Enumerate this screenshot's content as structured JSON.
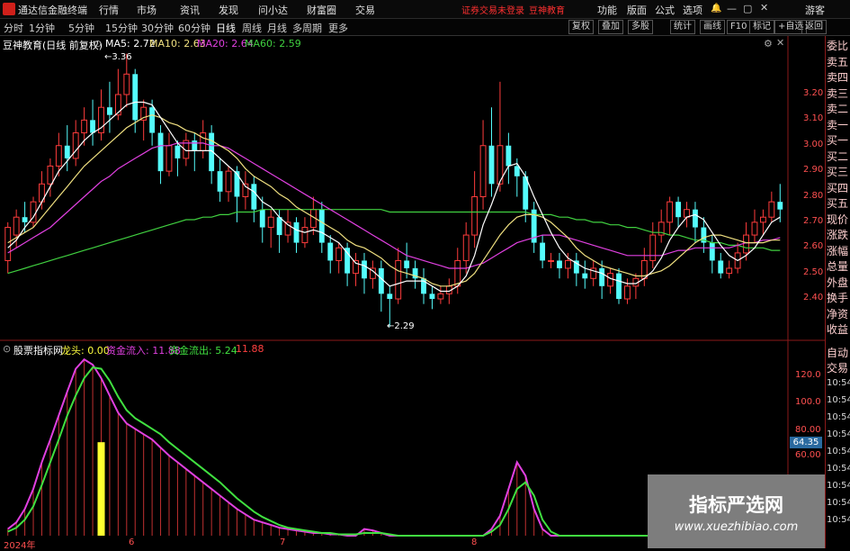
{
  "app": {
    "title": "通达信金融终端",
    "menu": [
      "行情",
      "市场",
      "资讯",
      "发现",
      "问小达",
      "财富圈",
      "交易"
    ],
    "notice": "证券交易未登录",
    "notice2": "豆神教育",
    "right_menu": [
      "功能",
      "版面",
      "公式",
      "选项"
    ],
    "guest": "游客"
  },
  "toolbar": {
    "periods": [
      "分时",
      "1分钟",
      "5分钟",
      "15分钟",
      "30分钟",
      "60分钟",
      "日线",
      "周线",
      "月线",
      "多周期",
      "更多"
    ],
    "buttons": [
      "复权",
      "叠加",
      "多股",
      "统计",
      "画线",
      "F10",
      "标记",
      "+自选",
      "返回"
    ]
  },
  "main_chart": {
    "stock_label": "豆神教育(日线 前复权)",
    "ma": [
      {
        "name": "MA5: 2.72",
        "color": "#ffffff"
      },
      {
        "name": "MA10: 2.63",
        "color": "#f0e080"
      },
      {
        "name": "MA20: 2.64",
        "color": "#e040e0"
      },
      {
        "name": "MA60: 2.59",
        "color": "#40d040"
      }
    ],
    "high_label": "3.36",
    "low_label": "2.29",
    "y_ticks": [
      "3.20",
      "3.10",
      "3.00",
      "2.90",
      "2.80",
      "2.70",
      "2.60",
      "2.50",
      "2.40"
    ]
  },
  "sub_chart": {
    "label": "股票指标网",
    "indicators": [
      {
        "name": "龙头: 0.00",
        "color": "#ffff40"
      },
      {
        "name": "资金流入: 11.88",
        "color": "#e040e0"
      },
      {
        "name": "资金流出: 5.24",
        "color": "#40e040"
      },
      {
        "name": "11.88",
        "color": "#ff4040"
      }
    ],
    "y_ticks": [
      "120.0",
      "100.0",
      "80.00",
      "60.00"
    ],
    "price_tag": "64.35",
    "x_labels": [
      "2024年",
      "6",
      "7",
      "8"
    ]
  },
  "right_panel": {
    "items": [
      "委比",
      "卖五",
      "卖四",
      "卖三",
      "卖二",
      "卖一",
      "买一",
      "买二",
      "买三",
      "买四",
      "买五",
      "现价",
      "涨跌",
      "涨幅",
      "总量",
      "外盘",
      "换手",
      "净资",
      "收益"
    ],
    "trade_items": [
      "自动",
      "交易"
    ],
    "times": [
      "10:54",
      "10:54",
      "10:54",
      "10:54",
      "10:54",
      "10:54",
      "10:54",
      "10:54",
      "10:54"
    ]
  },
  "watermark": {
    "title": "指标严选网",
    "url": "www.xuezhibiao.com"
  },
  "chart_data": {
    "type": "candlestick",
    "price_range": [
      2.29,
      3.36
    ],
    "candles": [
      [
        2.55,
        2.68,
        2.5,
        2.7
      ],
      [
        2.65,
        2.72,
        2.6,
        2.75
      ],
      [
        2.72,
        2.7,
        2.66,
        2.78
      ],
      [
        2.7,
        2.78,
        2.68,
        2.8
      ],
      [
        2.78,
        2.85,
        2.75,
        2.9
      ],
      [
        2.85,
        2.92,
        2.8,
        2.95
      ],
      [
        2.92,
        3.0,
        2.88,
        3.05
      ],
      [
        3.0,
        2.95,
        2.9,
        3.08
      ],
      [
        2.95,
        3.05,
        2.92,
        3.1
      ],
      [
        3.05,
        3.1,
        3.0,
        3.15
      ],
      [
        3.1,
        3.05,
        3.0,
        3.18
      ],
      [
        3.05,
        3.15,
        3.02,
        3.22
      ],
      [
        3.15,
        3.12,
        3.05,
        3.25
      ],
      [
        3.12,
        3.2,
        3.1,
        3.3
      ],
      [
        3.2,
        3.28,
        3.15,
        3.36
      ],
      [
        3.28,
        3.1,
        3.05,
        3.3
      ],
      [
        3.1,
        3.15,
        3.02,
        3.18
      ],
      [
        3.15,
        3.05,
        3.0,
        3.18
      ],
      [
        3.05,
        2.9,
        2.85,
        3.08
      ],
      [
        2.9,
        3.0,
        2.88,
        3.05
      ],
      [
        3.0,
        2.95,
        2.88,
        3.02
      ],
      [
        2.95,
        3.02,
        2.92,
        3.05
      ],
      [
        3.02,
        2.98,
        2.9,
        3.05
      ],
      [
        2.98,
        3.05,
        2.95,
        3.1
      ],
      [
        3.05,
        2.9,
        2.85,
        3.08
      ],
      [
        2.9,
        2.82,
        2.78,
        2.95
      ],
      [
        2.82,
        2.9,
        2.78,
        2.92
      ],
      [
        2.9,
        2.8,
        2.7,
        2.92
      ],
      [
        2.8,
        2.85,
        2.75,
        2.9
      ],
      [
        2.85,
        2.75,
        2.7,
        2.88
      ],
      [
        2.75,
        2.68,
        2.62,
        2.8
      ],
      [
        2.68,
        2.72,
        2.6,
        2.75
      ],
      [
        2.72,
        2.65,
        2.58,
        2.75
      ],
      [
        2.65,
        2.7,
        2.62,
        2.75
      ],
      [
        2.7,
        2.62,
        2.58,
        2.72
      ],
      [
        2.62,
        2.68,
        2.6,
        2.72
      ],
      [
        2.68,
        2.75,
        2.65,
        2.8
      ],
      [
        2.75,
        2.62,
        2.58,
        2.78
      ],
      [
        2.62,
        2.55,
        2.5,
        2.65
      ],
      [
        2.55,
        2.6,
        2.5,
        2.62
      ],
      [
        2.6,
        2.5,
        2.45,
        2.62
      ],
      [
        2.5,
        2.55,
        2.45,
        2.58
      ],
      [
        2.55,
        2.48,
        2.42,
        2.58
      ],
      [
        2.48,
        2.52,
        2.44,
        2.55
      ],
      [
        2.52,
        2.42,
        2.35,
        2.55
      ],
      [
        2.42,
        2.4,
        2.29,
        2.45
      ],
      [
        2.4,
        2.55,
        2.38,
        2.6
      ],
      [
        2.55,
        2.52,
        2.48,
        2.62
      ],
      [
        2.52,
        2.48,
        2.44,
        2.55
      ],
      [
        2.48,
        2.42,
        2.38,
        2.52
      ],
      [
        2.42,
        2.4,
        2.36,
        2.45
      ],
      [
        2.4,
        2.42,
        2.38,
        2.45
      ],
      [
        2.42,
        2.45,
        2.38,
        2.48
      ],
      [
        2.45,
        2.55,
        2.42,
        2.6
      ],
      [
        2.55,
        2.65,
        2.5,
        2.7
      ],
      [
        2.65,
        2.8,
        2.6,
        2.9
      ],
      [
        2.8,
        3.0,
        2.75,
        3.1
      ],
      [
        3.0,
        2.85,
        2.8,
        3.15
      ],
      [
        2.85,
        3.0,
        2.82,
        3.25
      ],
      [
        3.0,
        2.92,
        2.85,
        3.05
      ],
      [
        2.92,
        2.88,
        2.8,
        2.95
      ],
      [
        2.88,
        2.75,
        2.7,
        2.9
      ],
      [
        2.75,
        2.62,
        2.58,
        2.78
      ],
      [
        2.62,
        2.55,
        2.52,
        2.65
      ],
      [
        2.55,
        2.55,
        2.52,
        2.58
      ],
      [
        2.55,
        2.52,
        2.48,
        2.58
      ],
      [
        2.52,
        2.55,
        2.48,
        2.58
      ],
      [
        2.55,
        2.5,
        2.45,
        2.58
      ],
      [
        2.5,
        2.48,
        2.44,
        2.55
      ],
      [
        2.48,
        2.52,
        2.45,
        2.55
      ],
      [
        2.52,
        2.45,
        2.4,
        2.55
      ],
      [
        2.45,
        2.5,
        2.42,
        2.52
      ],
      [
        2.5,
        2.4,
        2.38,
        2.52
      ],
      [
        2.4,
        2.45,
        2.38,
        2.48
      ],
      [
        2.45,
        2.48,
        2.4,
        2.5
      ],
      [
        2.48,
        2.55,
        2.45,
        2.6
      ],
      [
        2.55,
        2.65,
        2.52,
        2.7
      ],
      [
        2.65,
        2.7,
        2.62,
        2.75
      ],
      [
        2.7,
        2.78,
        2.65,
        2.8
      ],
      [
        2.78,
        2.72,
        2.68,
        2.8
      ],
      [
        2.72,
        2.75,
        2.68,
        2.78
      ],
      [
        2.75,
        2.68,
        2.62,
        2.78
      ],
      [
        2.68,
        2.62,
        2.58,
        2.72
      ],
      [
        2.62,
        2.55,
        2.5,
        2.65
      ],
      [
        2.55,
        2.5,
        2.48,
        2.58
      ],
      [
        2.5,
        2.52,
        2.48,
        2.55
      ],
      [
        2.52,
        2.58,
        2.5,
        2.62
      ],
      [
        2.58,
        2.65,
        2.55,
        2.7
      ],
      [
        2.65,
        2.7,
        2.62,
        2.75
      ],
      [
        2.7,
        2.72,
        2.65,
        2.75
      ],
      [
        2.72,
        2.78,
        2.7,
        2.82
      ],
      [
        2.78,
        2.75,
        2.7,
        2.85
      ]
    ],
    "ma5": [
      2.6,
      2.63,
      2.68,
      2.72,
      2.78,
      2.84,
      2.9,
      2.94,
      2.98,
      3.02,
      3.05,
      3.07,
      3.1,
      3.13,
      3.16,
      3.17,
      3.17,
      3.16,
      3.11,
      3.06,
      3.01,
      2.98,
      2.98,
      2.98,
      2.98,
      2.95,
      2.92,
      2.89,
      2.84,
      2.82,
      2.78,
      2.76,
      2.72,
      2.69,
      2.67,
      2.66,
      2.67,
      2.66,
      2.64,
      2.62,
      2.58,
      2.54,
      2.53,
      2.51,
      2.48,
      2.45,
      2.46,
      2.47,
      2.47,
      2.47,
      2.45,
      2.43,
      2.43,
      2.45,
      2.49,
      2.57,
      2.69,
      2.77,
      2.86,
      2.92,
      2.93,
      2.88,
      2.8,
      2.73,
      2.66,
      2.6,
      2.56,
      2.54,
      2.52,
      2.51,
      2.5,
      2.48,
      2.47,
      2.46,
      2.46,
      2.48,
      2.51,
      2.56,
      2.63,
      2.68,
      2.72,
      2.73,
      2.71,
      2.66,
      2.61,
      2.57,
      2.55,
      2.57,
      2.6,
      2.65,
      2.7,
      2.72
    ],
    "ma10": [
      2.62,
      2.64,
      2.66,
      2.68,
      2.72,
      2.76,
      2.8,
      2.84,
      2.88,
      2.92,
      2.95,
      2.98,
      3.01,
      3.04,
      3.07,
      3.09,
      3.11,
      3.12,
      3.11,
      3.09,
      3.08,
      3.06,
      3.05,
      3.03,
      3.02,
      3.0,
      2.98,
      2.95,
      2.91,
      2.88,
      2.86,
      2.84,
      2.81,
      2.79,
      2.76,
      2.74,
      2.72,
      2.7,
      2.68,
      2.66,
      2.63,
      2.61,
      2.6,
      2.58,
      2.56,
      2.53,
      2.51,
      2.5,
      2.49,
      2.48,
      2.46,
      2.45,
      2.45,
      2.46,
      2.47,
      2.5,
      2.55,
      2.6,
      2.65,
      2.69,
      2.72,
      2.73,
      2.73,
      2.72,
      2.7,
      2.67,
      2.64,
      2.6,
      2.57,
      2.55,
      2.53,
      2.52,
      2.51,
      2.5,
      2.49,
      2.49,
      2.5,
      2.51,
      2.53,
      2.56,
      2.59,
      2.62,
      2.64,
      2.65,
      2.65,
      2.64,
      2.63,
      2.62,
      2.62,
      2.62,
      2.63,
      2.63
    ],
    "ma20": [
      2.58,
      2.6,
      2.62,
      2.64,
      2.66,
      2.68,
      2.71,
      2.74,
      2.77,
      2.8,
      2.83,
      2.86,
      2.88,
      2.91,
      2.93,
      2.95,
      2.97,
      2.99,
      3.0,
      3.0,
      3.01,
      3.01,
      3.01,
      3.01,
      3.0,
      3.0,
      2.99,
      2.97,
      2.95,
      2.93,
      2.91,
      2.89,
      2.87,
      2.85,
      2.83,
      2.81,
      2.79,
      2.77,
      2.75,
      2.73,
      2.71,
      2.69,
      2.67,
      2.65,
      2.63,
      2.61,
      2.59,
      2.57,
      2.56,
      2.55,
      2.54,
      2.53,
      2.52,
      2.52,
      2.52,
      2.53,
      2.54,
      2.56,
      2.58,
      2.6,
      2.62,
      2.63,
      2.64,
      2.65,
      2.65,
      2.65,
      2.64,
      2.63,
      2.62,
      2.61,
      2.6,
      2.59,
      2.58,
      2.57,
      2.57,
      2.57,
      2.57,
      2.57,
      2.58,
      2.59,
      2.59,
      2.6,
      2.6,
      2.6,
      2.6,
      2.6,
      2.61,
      2.62,
      2.62,
      2.63,
      2.63,
      2.64
    ],
    "ma60": [
      2.5,
      2.51,
      2.52,
      2.53,
      2.54,
      2.55,
      2.56,
      2.57,
      2.58,
      2.59,
      2.6,
      2.61,
      2.62,
      2.63,
      2.64,
      2.65,
      2.66,
      2.67,
      2.68,
      2.69,
      2.7,
      2.71,
      2.71,
      2.72,
      2.72,
      2.73,
      2.73,
      2.74,
      2.74,
      2.74,
      2.75,
      2.75,
      2.75,
      2.75,
      2.75,
      2.75,
      2.75,
      2.75,
      2.75,
      2.75,
      2.75,
      2.75,
      2.75,
      2.75,
      2.75,
      2.74,
      2.74,
      2.74,
      2.74,
      2.74,
      2.74,
      2.74,
      2.74,
      2.74,
      2.74,
      2.74,
      2.74,
      2.74,
      2.74,
      2.74,
      2.74,
      2.74,
      2.73,
      2.73,
      2.73,
      2.72,
      2.72,
      2.71,
      2.71,
      2.7,
      2.7,
      2.69,
      2.69,
      2.68,
      2.68,
      2.67,
      2.66,
      2.66,
      2.65,
      2.65,
      2.64,
      2.63,
      2.63,
      2.62,
      2.62,
      2.61,
      2.61,
      2.6,
      2.6,
      2.6,
      2.59,
      2.59
    ],
    "flow_in": [
      5,
      10,
      20,
      35,
      55,
      72,
      90,
      108,
      125,
      132,
      128,
      118,
      105,
      92,
      84,
      80,
      76,
      72,
      66,
      60,
      55,
      50,
      45,
      40,
      35,
      30,
      25,
      20,
      16,
      12,
      10,
      8,
      6,
      5,
      4,
      3,
      2,
      2,
      1,
      1,
      0,
      0,
      5,
      4,
      2,
      0,
      0,
      0,
      0,
      0,
      0,
      0,
      0,
      0,
      0,
      0,
      0,
      5,
      15,
      35,
      55,
      45,
      20,
      5,
      0,
      0,
      0,
      0,
      0,
      0,
      0,
      0,
      0,
      0,
      0,
      0,
      0,
      0,
      0,
      0,
      0,
      0,
      0,
      0,
      0,
      0,
      0,
      0,
      0,
      0,
      0,
      0
    ],
    "flow_out": [
      3,
      6,
      12,
      22,
      38,
      55,
      72,
      90,
      105,
      118,
      126,
      125,
      116,
      104,
      94,
      88,
      84,
      80,
      76,
      70,
      65,
      60,
      55,
      50,
      45,
      40,
      34,
      28,
      23,
      18,
      14,
      11,
      8,
      6,
      5,
      4,
      3,
      2,
      2,
      1,
      1,
      1,
      2,
      2,
      2,
      1,
      0,
      0,
      0,
      0,
      0,
      0,
      0,
      0,
      0,
      0,
      0,
      3,
      8,
      20,
      35,
      40,
      30,
      12,
      3,
      0,
      0,
      0,
      0,
      0,
      0,
      0,
      0,
      0,
      0,
      0,
      0,
      0,
      0,
      0,
      0,
      0,
      0,
      0,
      0,
      0,
      0,
      0,
      0,
      0,
      0,
      0
    ],
    "leader_bar_index": 11,
    "sub_range": [
      0,
      140
    ]
  }
}
